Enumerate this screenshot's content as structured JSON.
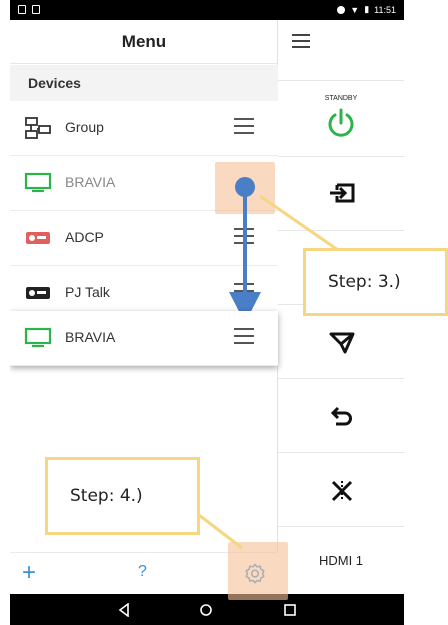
{
  "status_bar": {
    "time": "11:51"
  },
  "menu": {
    "title": "Menu",
    "section": "Devices",
    "items": [
      {
        "label": "Group",
        "icon": "group-network-icon"
      },
      {
        "label": "BRAVIA",
        "icon": "tv-icon"
      },
      {
        "label": "ADCP",
        "icon": "projector-icon"
      },
      {
        "label": "PJ Talk",
        "icon": "projector-icon"
      },
      {
        "label": "BRAVIA",
        "icon": "tv-icon"
      }
    ],
    "footer": {
      "add": "+",
      "help": "?"
    }
  },
  "remote": {
    "standby_label": "STANDBY",
    "input_label": "HDMI 1"
  },
  "callouts": {
    "step3": "Step: 3.)",
    "step4": "Step: 4.)"
  },
  "colors": {
    "accent_blue": "#3a8fd9",
    "power_green": "#2db34a",
    "tv_green": "#2db34a",
    "projector_red": "#e0605e",
    "highlight": "#f5c096",
    "callout_border": "#f6d680",
    "arrow_blue": "#4a7ec6"
  }
}
